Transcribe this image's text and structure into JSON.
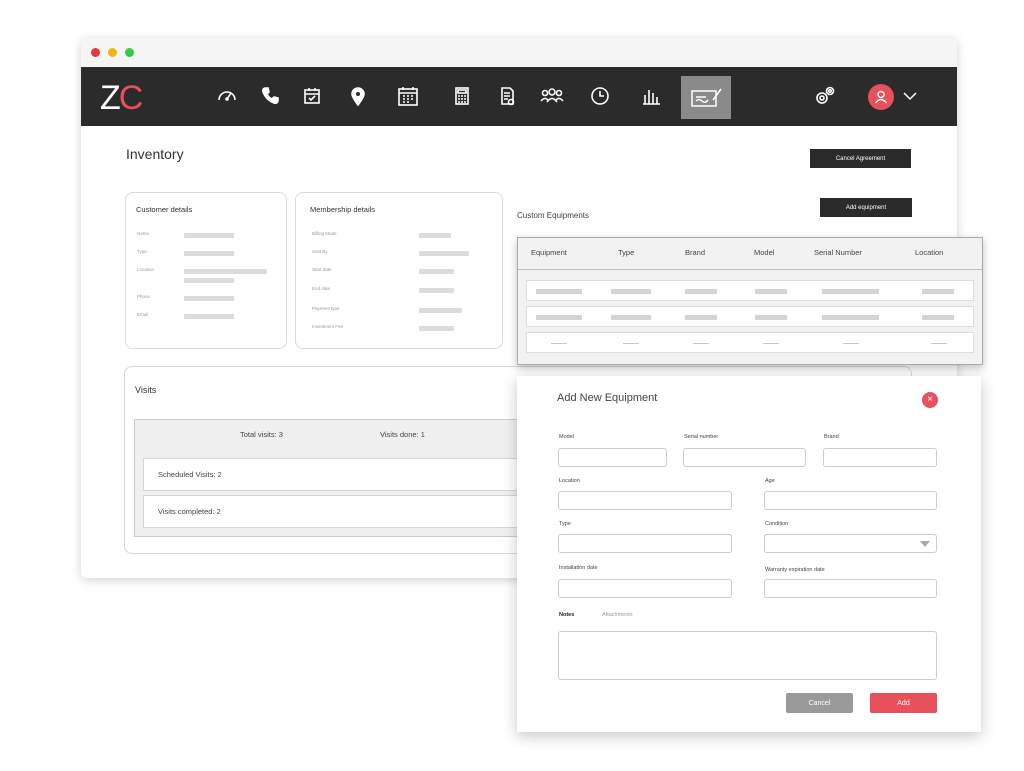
{
  "app": {
    "logo_z": "Z",
    "logo_c": "C"
  },
  "nav": {
    "icons": [
      "speedometer-icon",
      "phone-icon",
      "calendar-check-icon",
      "location-pin-icon",
      "calendar-icon",
      "calculator-icon",
      "document-icon",
      "team-icon",
      "clock-icon",
      "bar-chart-icon",
      "contract-signature-icon"
    ],
    "active": "contract-signature-icon",
    "settings_icon": "gears-icon",
    "user_icon": "user-avatar-icon",
    "accent": "#e8505b"
  },
  "page": {
    "title": "Inventory",
    "cancel_agreement": "Cancel Agreement",
    "add_equipment": "Add equipment"
  },
  "customer": {
    "title": "Customer details",
    "labels": [
      "Name",
      "Type",
      "Location",
      "Phone",
      "Email"
    ]
  },
  "membership": {
    "title": "Membership details",
    "labels": [
      "Billing Mode",
      "Sold By",
      "Start date",
      "End date",
      "Payment type",
      "Investment Fee"
    ]
  },
  "equipment": {
    "title": "Custom Equipments",
    "columns": [
      "Equipment",
      "Type",
      "Brand",
      "Model",
      "Serial Number",
      "Location"
    ]
  },
  "visits": {
    "title": "Visits",
    "total": "Total visits: 3",
    "done": "Visits done: 1",
    "scheduled": "Scheduled Visits: 2",
    "completed": "Visits completed: 2"
  },
  "modal": {
    "title": "Add New Equipment",
    "close": "×",
    "fields": {
      "model": "Model",
      "serial": "Serial number",
      "brand": "Brand",
      "location": "Location",
      "age": "Age",
      "type": "Type",
      "condition": "Condition",
      "install": "Installation date",
      "warranty": "Warranty expiration date"
    },
    "tabs": {
      "notes": "Notes",
      "attachments": "Attachments"
    },
    "cancel": "Cancel",
    "add": "Add"
  }
}
